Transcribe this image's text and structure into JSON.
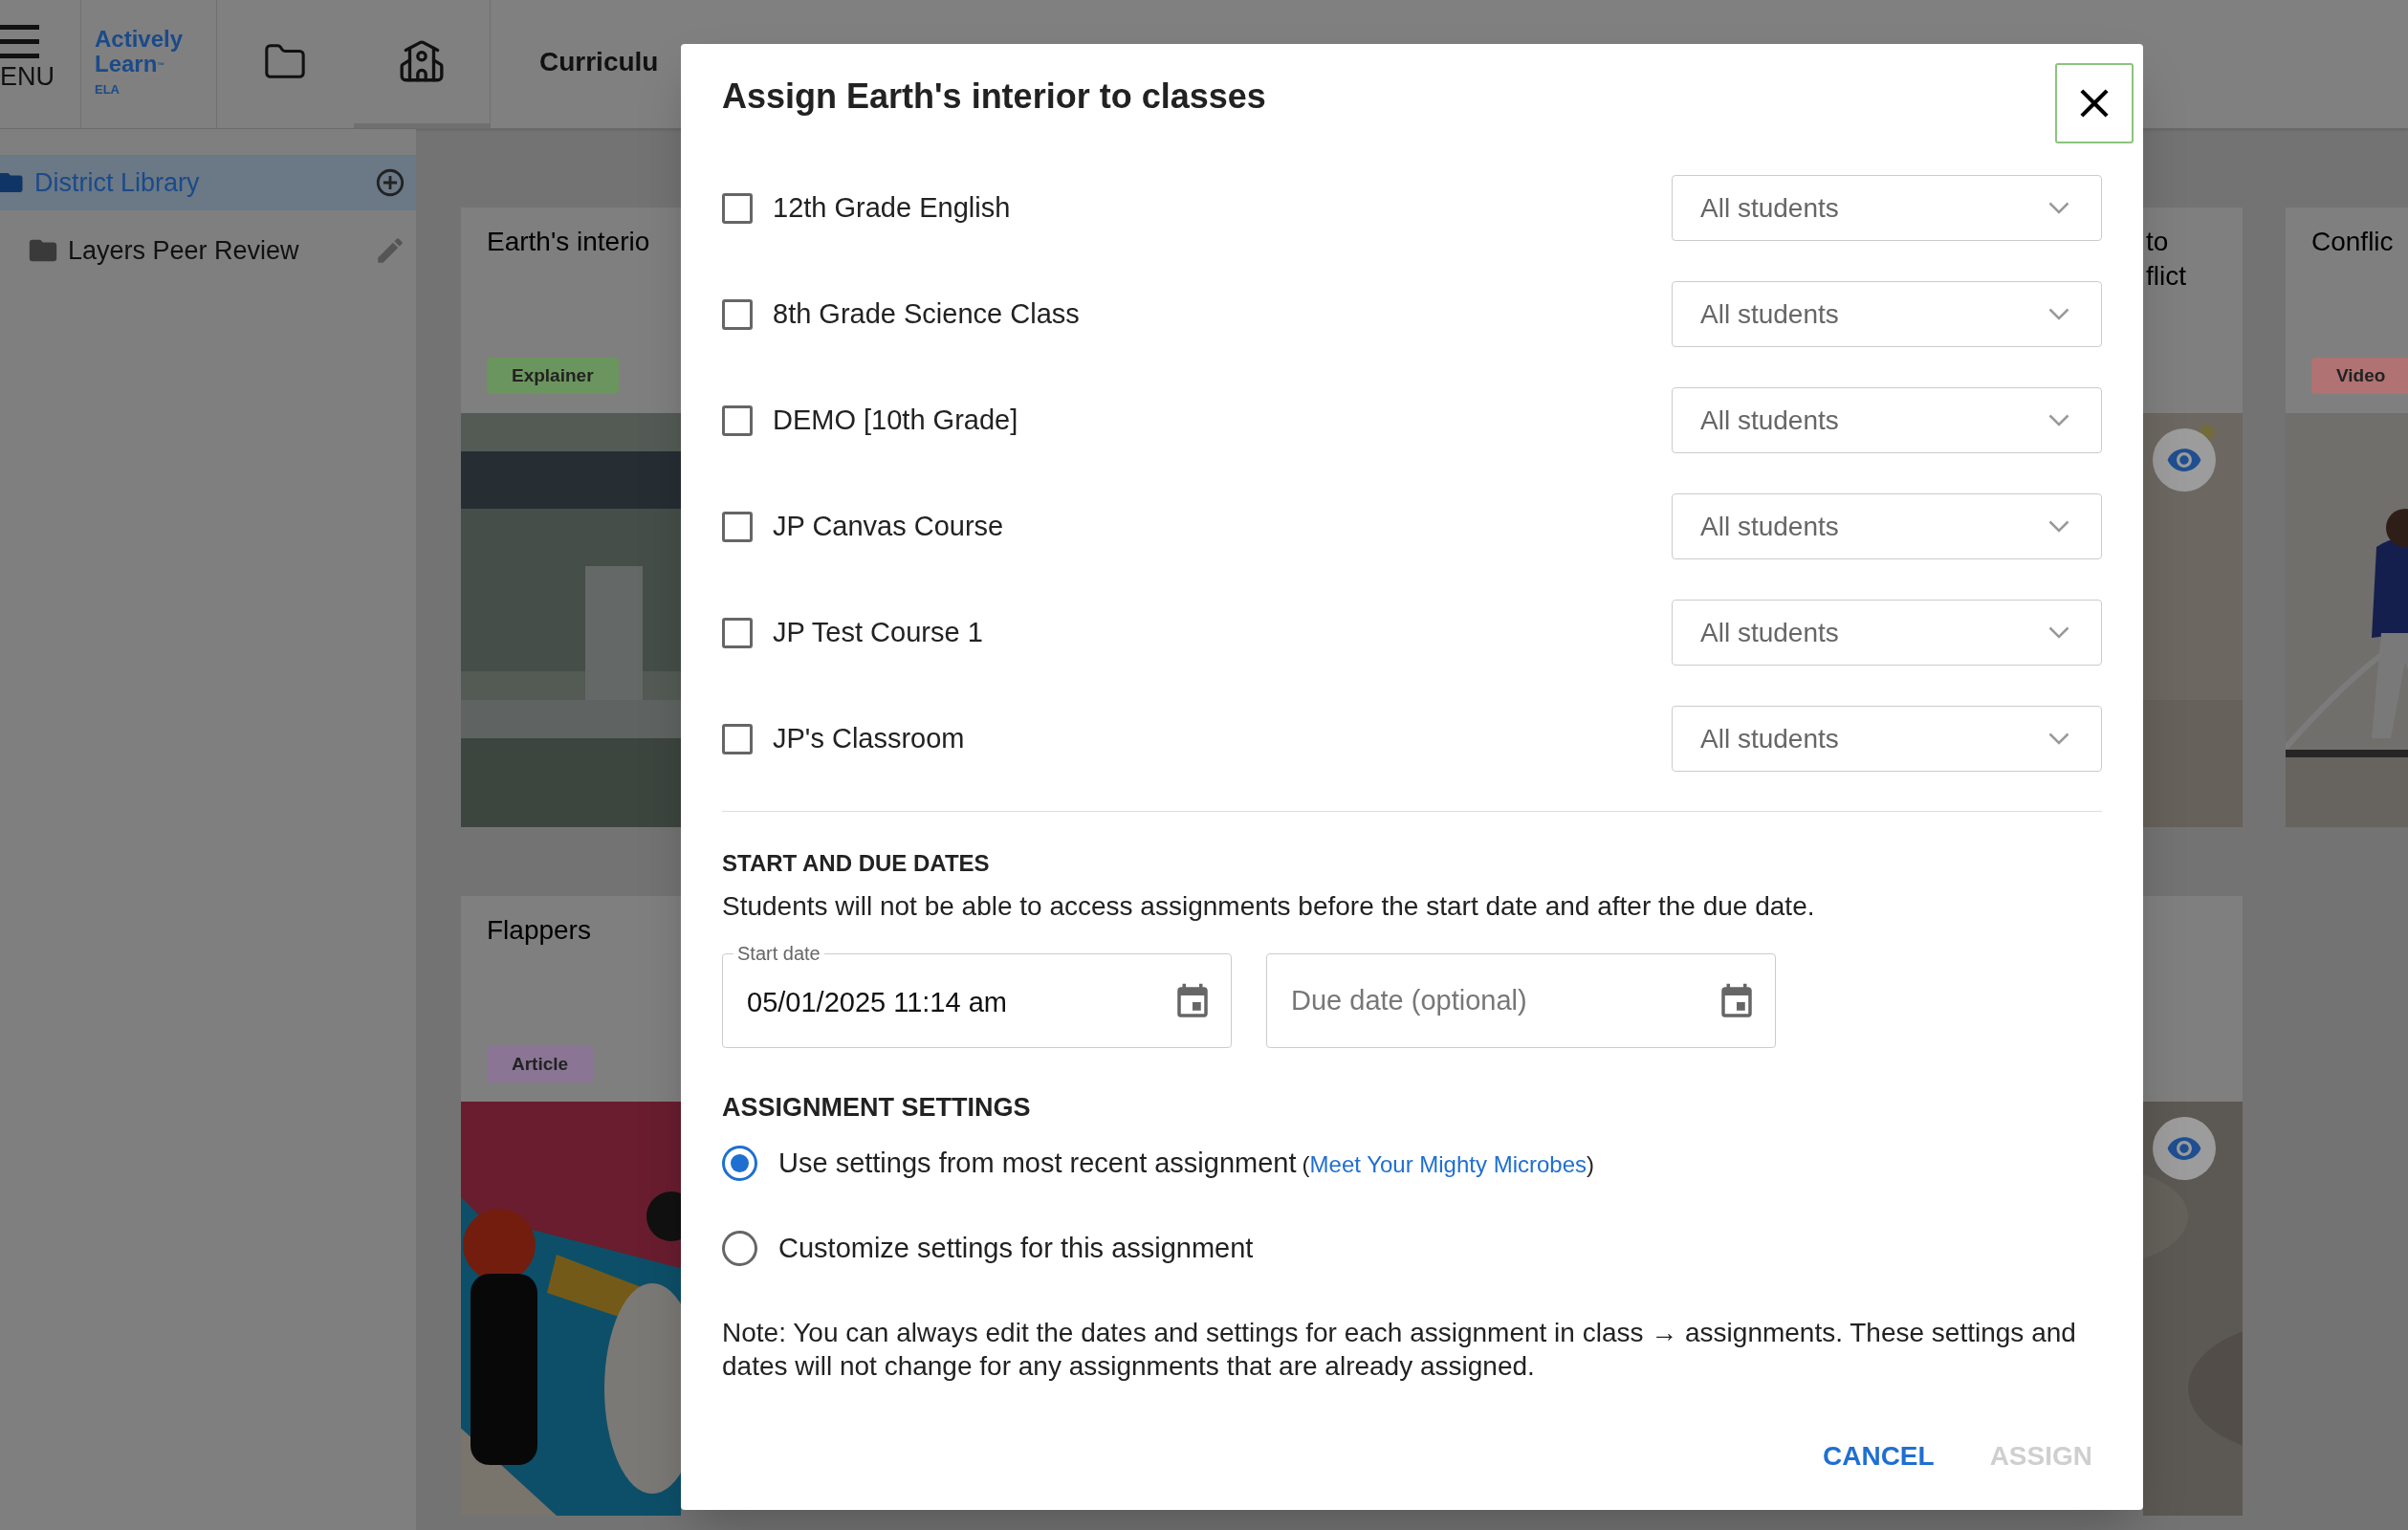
{
  "header": {
    "menu_label": "ENU",
    "logo": {
      "lines": [
        "Actively",
        "Learn"
      ],
      "trademark": "™",
      "subtitle": "ELA"
    },
    "tabs": [
      {
        "kind": "folder",
        "selected": false
      },
      {
        "kind": "school",
        "selected": true
      },
      {
        "kind": "text",
        "label": "Curriculu",
        "selected": false
      }
    ]
  },
  "sidebar": {
    "items": [
      {
        "label": "District Library",
        "selected": true,
        "children": [
          {
            "label": "Layers Peer Review",
            "selected": false
          }
        ]
      }
    ]
  },
  "card_rows": [
    [
      {
        "kind": "left",
        "title_lines": [
          "Earth's interio"
        ],
        "tag": {
          "label": "Explainer",
          "color": "#6b955e"
        },
        "image": {
          "kind": "picture"
        }
      },
      {
        "kind": "clipped",
        "title_lines": [
          "to",
          "flict"
        ],
        "preview": true,
        "image": {
          "kind": "picture"
        }
      },
      {
        "kind": "full",
        "title_lines": [
          "Conflic"
        ],
        "tag": {
          "label": "Video",
          "color": "#b07272"
        },
        "image": {
          "kind": "picture"
        }
      }
    ],
    [
      {
        "kind": "left",
        "title_lines": [
          "Flappers"
        ],
        "tag": {
          "label": "Article",
          "color": "#8a7595"
        },
        "image": {
          "kind": "picture"
        }
      },
      {
        "kind": "clipped",
        "preview": true,
        "image": {
          "kind": "picture"
        }
      }
    ]
  ],
  "modal": {
    "title": "Assign Earth's interior to classes",
    "classes": [
      {
        "name": "12th Grade English",
        "checked": false,
        "audience": "All students"
      },
      {
        "name": "8th Grade Science Class",
        "checked": false,
        "audience": "All students"
      },
      {
        "name": "DEMO [10th Grade]",
        "checked": false,
        "audience": "All students"
      },
      {
        "name": "JP Canvas Course",
        "checked": false,
        "audience": "All students"
      },
      {
        "name": "JP Test Course 1",
        "checked": false,
        "audience": "All students"
      },
      {
        "name": "JP's Classroom",
        "checked": false,
        "audience": "All students"
      }
    ],
    "dates": {
      "heading": "START AND DUE DATES",
      "description": "Students will not be able to access assignments before the start date and after the due date.",
      "start": {
        "label": "Start date",
        "value": "05/01/2025 11:14 am"
      },
      "due": {
        "placeholder": "Due date (optional)"
      }
    },
    "settings": {
      "heading": "ASSIGNMENT SETTINGS",
      "options": [
        {
          "label": "Use settings from most recent assignment",
          "link_before": "(",
          "link": "Meet Your Mighty Microbes",
          "link_after": ")",
          "selected": true
        },
        {
          "label": "Customize settings for this assignment",
          "selected": false
        }
      ]
    },
    "note": "Note: You can always edit the dates and settings for each assignment in class → assignments. These settings and dates will not change for any assignments that are already assigned.",
    "buttons": [
      {
        "label": "CANCEL",
        "disabled": false
      },
      {
        "label": "ASSIGN",
        "disabled": true
      }
    ]
  }
}
